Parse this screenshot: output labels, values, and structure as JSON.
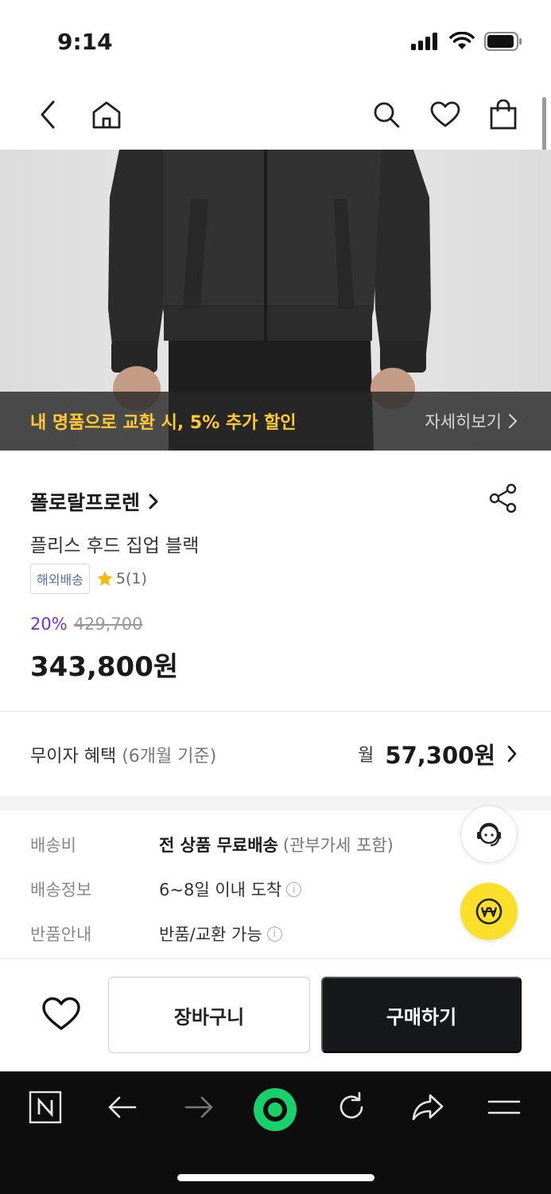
{
  "status_bar": {
    "time": "9:14"
  },
  "hero": {
    "promo_text": "내 명품으로 교환 시, 5% 추가 할인",
    "promo_more": "자세히보기"
  },
  "product": {
    "brand": "폴로랄프로렌",
    "name": "플리스 후드 집업 블랙",
    "badge": "해외배송",
    "rating": "5(1)",
    "discount": "20%",
    "original_price": "429,700",
    "price": "343,800원"
  },
  "installment": {
    "label": "무이자 혜택",
    "sub_label": "(6개월 기준)",
    "prefix": "월",
    "amount": "57,300원"
  },
  "shipping": {
    "rows": [
      {
        "key": "배송비",
        "value_bold": "전 상품 무료배송",
        "value_muted": "(관부가세 포함)"
      },
      {
        "key": "배송정보",
        "value": "6~8일 이내 도착"
      },
      {
        "key": "반품안내",
        "value": "반품/교환 가능"
      }
    ]
  },
  "actions": {
    "cart": "장바구니",
    "buy": "구매하기"
  },
  "colors": {
    "promo_text": "#ffc933",
    "discount": "#7b2fd0",
    "buy_button": "#16181c",
    "won_fab": "#fae02a",
    "browser_green": "#19d16a"
  }
}
